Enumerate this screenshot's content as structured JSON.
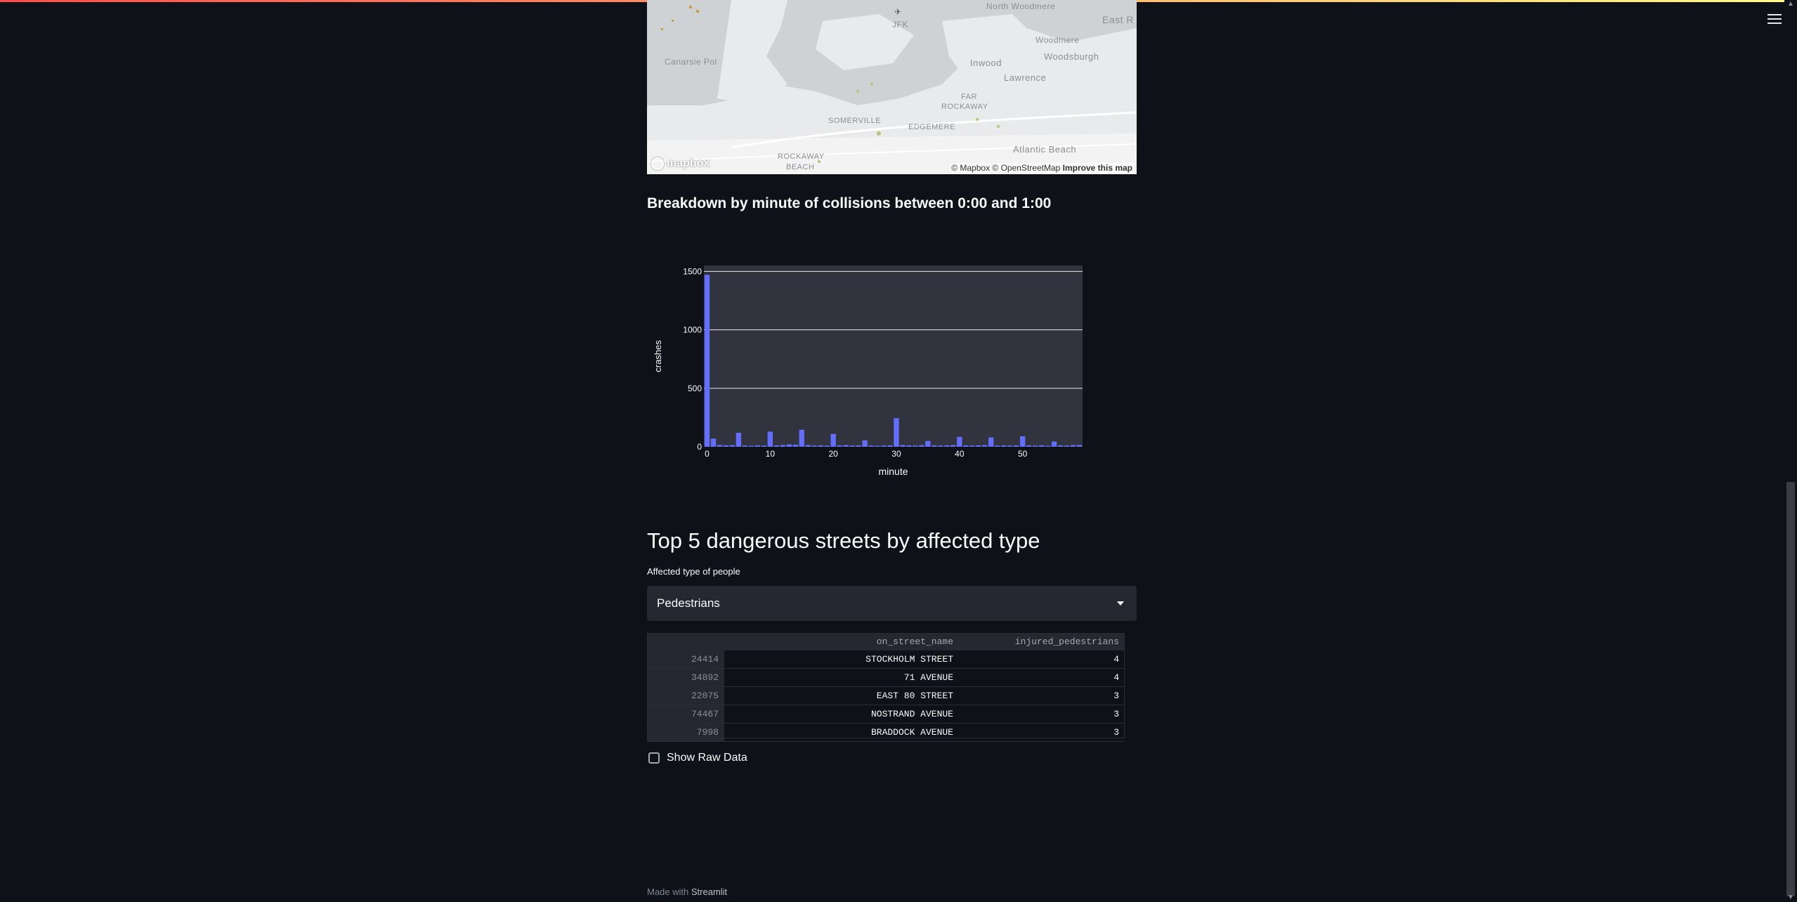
{
  "map": {
    "labels": [
      "North Woodmere",
      "East R",
      "JFK",
      "Woodmere",
      "Woodsburgh",
      "Canarsie Pol",
      "Inwood",
      "Lawrence",
      "FAR",
      "ROCKAWAY",
      "SOMERVILLE",
      "EDGEMERE",
      "ROCKAWAY",
      "BEACH",
      "Atlantic Beach"
    ],
    "logo_text": "mapbox",
    "attribution": "© Mapbox © OpenStreetMap",
    "improve_link": "Improve this map"
  },
  "minute_section": {
    "title": "Breakdown by minute of collisions between 0:00 and 1:00"
  },
  "chart_data": {
    "type": "bar",
    "xlabel": "minute",
    "ylabel": "crashes",
    "x": [
      0,
      1,
      2,
      3,
      4,
      5,
      6,
      7,
      8,
      9,
      10,
      11,
      12,
      13,
      14,
      15,
      16,
      17,
      18,
      19,
      20,
      21,
      22,
      23,
      24,
      25,
      26,
      27,
      28,
      29,
      30,
      31,
      32,
      33,
      34,
      35,
      36,
      37,
      38,
      39,
      40,
      41,
      42,
      43,
      44,
      45,
      46,
      47,
      48,
      49,
      50,
      51,
      52,
      53,
      54,
      55,
      56,
      57,
      58,
      59
    ],
    "values": [
      1470,
      70,
      15,
      12,
      14,
      120,
      10,
      8,
      12,
      10,
      130,
      12,
      15,
      20,
      18,
      145,
      15,
      10,
      12,
      10,
      110,
      12,
      15,
      10,
      12,
      55,
      10,
      8,
      10,
      12,
      245,
      15,
      12,
      10,
      14,
      50,
      12,
      10,
      12,
      15,
      85,
      12,
      10,
      12,
      14,
      80,
      10,
      12,
      10,
      12,
      90,
      12,
      10,
      12,
      8,
      45,
      12,
      10,
      14,
      15
    ],
    "xticks": [
      "0",
      "10",
      "20",
      "30",
      "40",
      "50"
    ],
    "yticks": [
      "0",
      "500",
      "1000",
      "1500"
    ],
    "ylim": [
      0,
      1550
    ],
    "grid": true,
    "bar_color": "#636efa"
  },
  "streets_section": {
    "title": "Top 5 dangerous streets by affected type",
    "select_label": "Affected type of people",
    "select_value": "Pedestrians",
    "table": {
      "headers": [
        "",
        "on_street_name",
        "injured_pedestrians"
      ],
      "rows": [
        {
          "idx": "24414",
          "street": "STOCKHOLM STREET",
          "injured": "4"
        },
        {
          "idx": "34892",
          "street": "71 AVENUE",
          "injured": "4"
        },
        {
          "idx": "22075",
          "street": "EAST 80 STREET",
          "injured": "3"
        },
        {
          "idx": "74467",
          "street": "NOSTRAND AVENUE",
          "injured": "3"
        },
        {
          "idx": "7998",
          "street": "BRADDOCK AVENUE",
          "injured": "3"
        }
      ]
    },
    "checkbox_label": "Show Raw Data"
  },
  "footer": {
    "made_with": "Made with",
    "brand": "Streamlit"
  },
  "colors": {
    "background": "#0e1117",
    "widget": "#262730",
    "plot_bg": "#31333f",
    "accent_gradient": [
      "#ff4b4b",
      "#fffd80"
    ]
  }
}
